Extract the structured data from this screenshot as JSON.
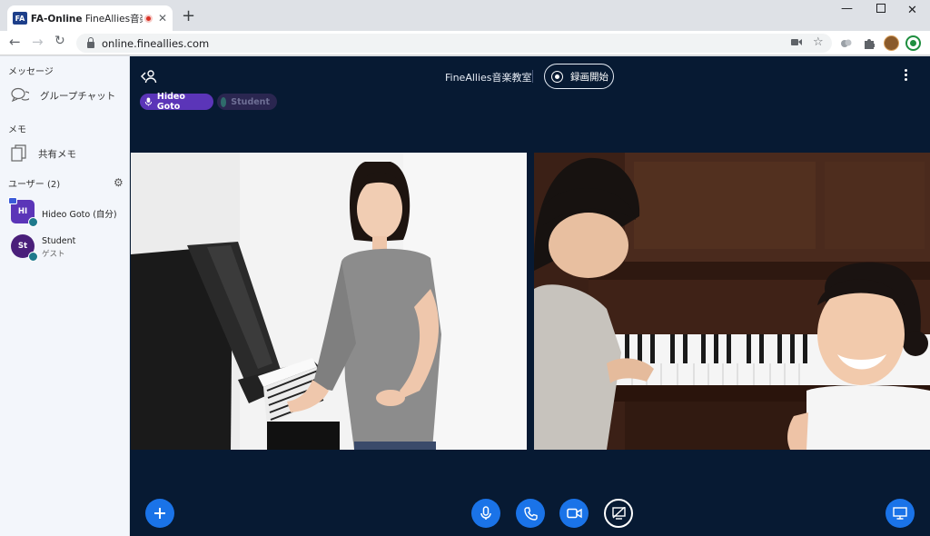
{
  "browser": {
    "tab_prefix": "FA-Online",
    "tab_suffix": "FineAllies音楽教",
    "favicon_text": "FA",
    "url": "online.fineallies.com"
  },
  "sidebar": {
    "messages_heading": "メッセージ",
    "group_chat_label": "グループチャット",
    "memo_heading": "メモ",
    "shared_memo_label": "共有メモ",
    "users_heading": "ユーザー (2)",
    "users": [
      {
        "initials": "HI",
        "name": "Hideo Goto (自分)",
        "role": "",
        "color": "#5b35b8"
      },
      {
        "initials": "St",
        "name": "Student",
        "role": "ゲスト",
        "color": "#4a1f7a"
      }
    ]
  },
  "main": {
    "room_title": "FineAllies音楽教室",
    "record_label": "録画開始",
    "participants": [
      {
        "name": "Hideo Goto",
        "active": true
      },
      {
        "name": "Student",
        "active": false
      }
    ]
  },
  "colors": {
    "stage_bg": "#071a33",
    "accent": "#1a73e8",
    "chip_active": "#5b35b8"
  }
}
